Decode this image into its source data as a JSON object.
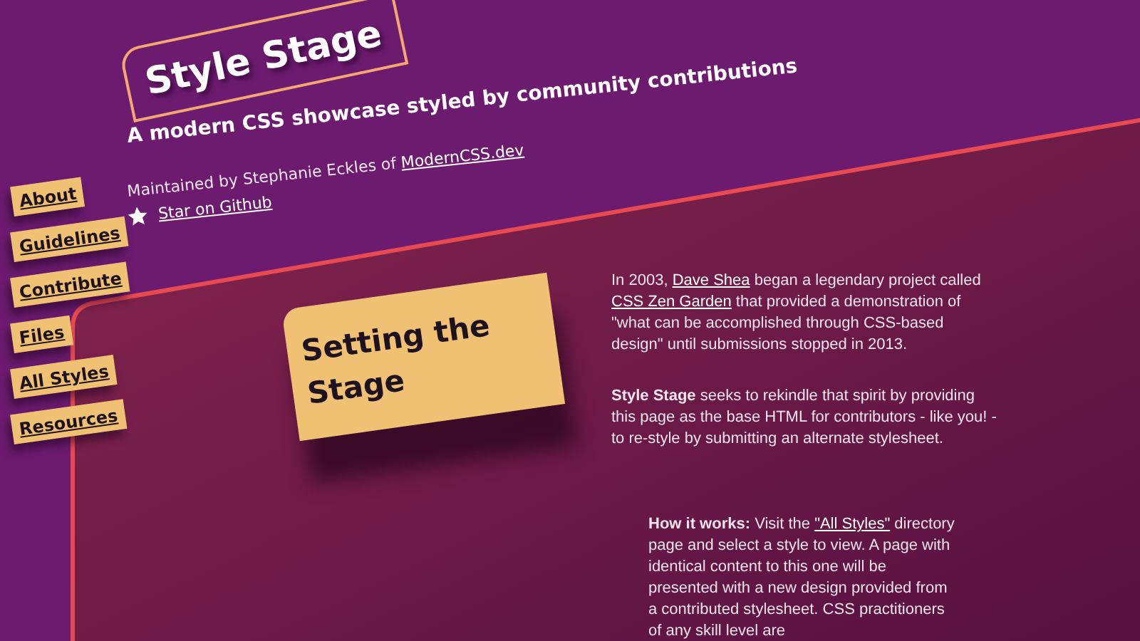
{
  "header": {
    "title": "Style Stage",
    "tagline": "A modern CSS showcase styled by community contributions",
    "maintainer": [
      {
        "text": "Maintained by Stephanie Eckles of "
      },
      {
        "link": "ModernCSS.dev"
      }
    ],
    "star_link": "Star on Github"
  },
  "nav": [
    {
      "label": "About"
    },
    {
      "label": "Guidelines"
    },
    {
      "label": "Contribute"
    },
    {
      "label": "Files"
    },
    {
      "label": "All Styles"
    },
    {
      "label": "Resources"
    }
  ],
  "main": {
    "heading": "Setting the Stage",
    "paragraphs": [
      {
        "indented": false,
        "segments": [
          {
            "text": "In 2003, "
          },
          {
            "link": "Dave Shea"
          },
          {
            "text": " began a legendary project called "
          },
          {
            "link": "CSS Zen Garden"
          },
          {
            "text": " that provided a demonstration of \"what can be accomplished through CSS-based design\" until submissions stopped in 2013."
          }
        ]
      },
      {
        "indented": false,
        "segments": [
          {
            "text": "**Style Stage** seeks to rekindle that spirit by providing this page as the base HTML for contributors - like you! - to re-style by submitting an alternate stylesheet."
          }
        ]
      },
      {
        "indented": true,
        "segments": [
          {
            "text": "**How it works:** Visit the "
          },
          {
            "link": "\"All Styles\""
          },
          {
            "text": " directory page and select a style to view. A page with identical content to this one will be presented with a new design provided from a contributed stylesheet. CSS practitioners of any skill level are"
          }
        ]
      }
    ]
  }
}
